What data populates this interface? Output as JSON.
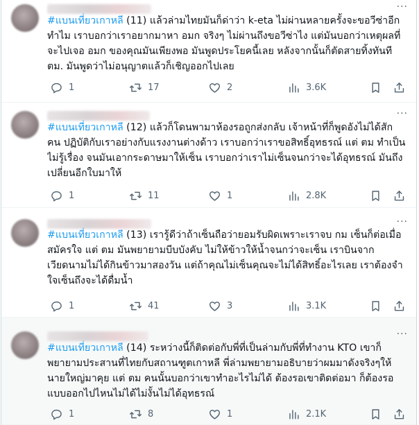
{
  "tweets": [
    {
      "lines": [
        {
          "tag": "#แบนเที่ยวเกาหลี",
          "text": " (11) แล้วล่ามไทยมันก็ด่าว่า k-eta ไม่ผ่านหลายครั้งจะขอวีซ่าอีก"
        },
        {
          "tag": "",
          "text": "ทำไม เราบอกว่าเราอยากมาหา อมก จริงๆ ไม่ผ่านถึงขอวีซ่าไง  แต่มันบอกว่าเหตุผลที่"
        },
        {
          "tag": "",
          "text": "จะไปเจอ อมก ของคุณมันเพียงพอ มันพูดประโยคนี้เลย หลังจากนั้นก็ตัดสายทิ้งทันที"
        },
        {
          "tag": "",
          "text": "ตม. มันพูดว่าไม่อนุญาตแล้วก็เชิญออกไปเลย"
        }
      ],
      "reply": "1",
      "retweet": "17",
      "like": "2",
      "views": "3.6K"
    },
    {
      "lines": [
        {
          "tag": "#แบนเที่ยวเกาหลี",
          "text": " (12) แล้วก็โดนพามาห้องรอถูกส่งกลับ เจ้าหน้าที่ก็พูดอังไม่ได้สัก"
        },
        {
          "tag": "",
          "text": "คน ปฏิบัติกับเราอย่างกับแรงงานต่างด้าว เราบอกว่าเราขอสิทธิ์อุทธรณ์ แต่ ตม ทำเป็น"
        },
        {
          "tag": "",
          "text": "ไม่รู้เรื่อง จนมันเอากระดาษมาให้เซ็น เราบอกว่าเราไม่เซ็นจนกว่าจะได้อุทธรณ์ มันถึง"
        },
        {
          "tag": "",
          "text": "เปลี่ยนอีกใบมาให้"
        }
      ],
      "reply": "1",
      "retweet": "11",
      "like": "1",
      "views": "2.8K"
    },
    {
      "lines": [
        {
          "tag": "#แบนเที่ยวเกาหลี",
          "text": " (13) เรารู้ดีว่าถ้าเซ็นถือว่ายอมรับผิดเพราะเราจบ กม เซ็นก็ต่อเมื่อ"
        },
        {
          "tag": "",
          "text": "สมัครใจ แต่ ตม มันพยายามบีบบังคับ ไม่ให้ข้าวให้น้ำจนกว่าจะเซ็น เราบินจาก"
        },
        {
          "tag": "",
          "text": "เวียดนามไม่ได้กินข้าวมาสองวัน แต่ถ้าคุณไม่เซ็นคุณจะไม่ได้สิทธิ์อะไรเลย เราต้องจำ"
        },
        {
          "tag": "",
          "text": "ใจเซ็นถึงจะได้ดื่มน้ำ"
        }
      ],
      "reply": "1",
      "retweet": "41",
      "like": "3",
      "views": "3.1K"
    },
    {
      "lines": [
        {
          "tag": "#แบนเที่ยวเกาหลี",
          "text": " (14) ระหว่างนี้ก็ติดต่อกับพี่ที่เป็นล่ามกับพี่ที่ทำงาน KTO เขาก็"
        },
        {
          "tag": "",
          "text": "พยายามประสานที่ไทยกับสถานฑูตเกาหลี พี่ล่ามพยายามอธิบายว่าผมมาดังจริงๆให้"
        },
        {
          "tag": "",
          "text": "นายใหญ่มาคุย แต่ ตม คนนั้นบอกว่าเขาทำอะไรไม่ได้ ต้องรอเขาติดต่อมา ก็ต้องรอ"
        },
        {
          "tag": "",
          "text": "แบบออกไปไหนไม่ได้ไม่งั้นไม่ได้อุทธรณ์"
        }
      ],
      "reply": "1",
      "retweet": "8",
      "like": "1",
      "views": "2.1K"
    }
  ]
}
